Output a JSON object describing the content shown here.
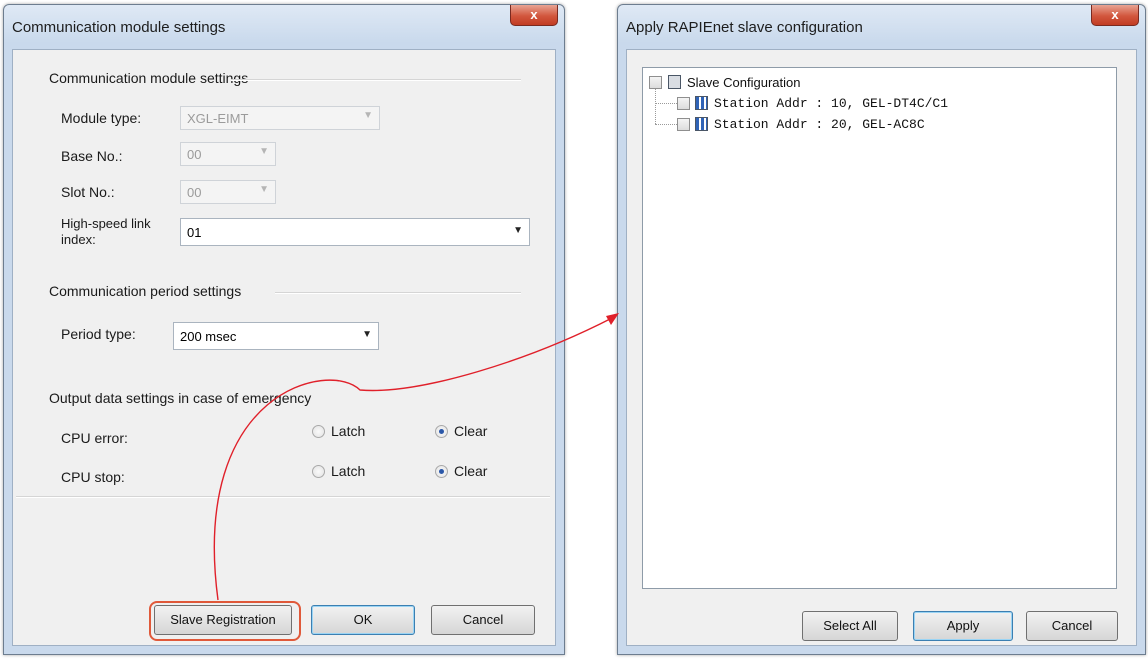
{
  "left_window": {
    "title": "Communication module settings",
    "close_glyph": "x",
    "module_group": {
      "title": "Communication module settings",
      "module_type_label": "Module type:",
      "module_type_value": "XGL-EIMT",
      "base_no_label": "Base No.:",
      "base_no_value": "00",
      "slot_no_label": "Slot No.:",
      "slot_no_value": "00",
      "hs_link_label_line1": "High-speed link",
      "hs_link_label_line2": "index:",
      "hs_link_value": "01"
    },
    "period_group": {
      "title": "Communication period settings",
      "period_type_label": "Period type:",
      "period_type_value": "200 msec"
    },
    "emergency_group": {
      "title": "Output data settings in case of emergency",
      "cpu_error_label": "CPU error:",
      "cpu_stop_label": "CPU stop:",
      "latch_label": "Latch",
      "clear_label": "Clear",
      "cpu_error_selected": "Clear",
      "cpu_stop_selected": "Clear"
    },
    "buttons": {
      "slave_registration": "Slave Registration",
      "ok": "OK",
      "cancel": "Cancel"
    }
  },
  "right_window": {
    "title": "Apply RAPIEnet slave configuration",
    "close_glyph": "x",
    "tree": {
      "root_label": "Slave Configuration",
      "children": [
        {
          "label": "Station Addr : 10, GEL-DT4C/C1"
        },
        {
          "label": "Station Addr : 20, GEL-AC8C"
        }
      ]
    },
    "buttons": {
      "select_all": "Select All",
      "apply": "Apply",
      "cancel": "Cancel"
    }
  },
  "annotation": {
    "highlight_color": "#e0593a",
    "arrow_color": "#e0202a"
  }
}
